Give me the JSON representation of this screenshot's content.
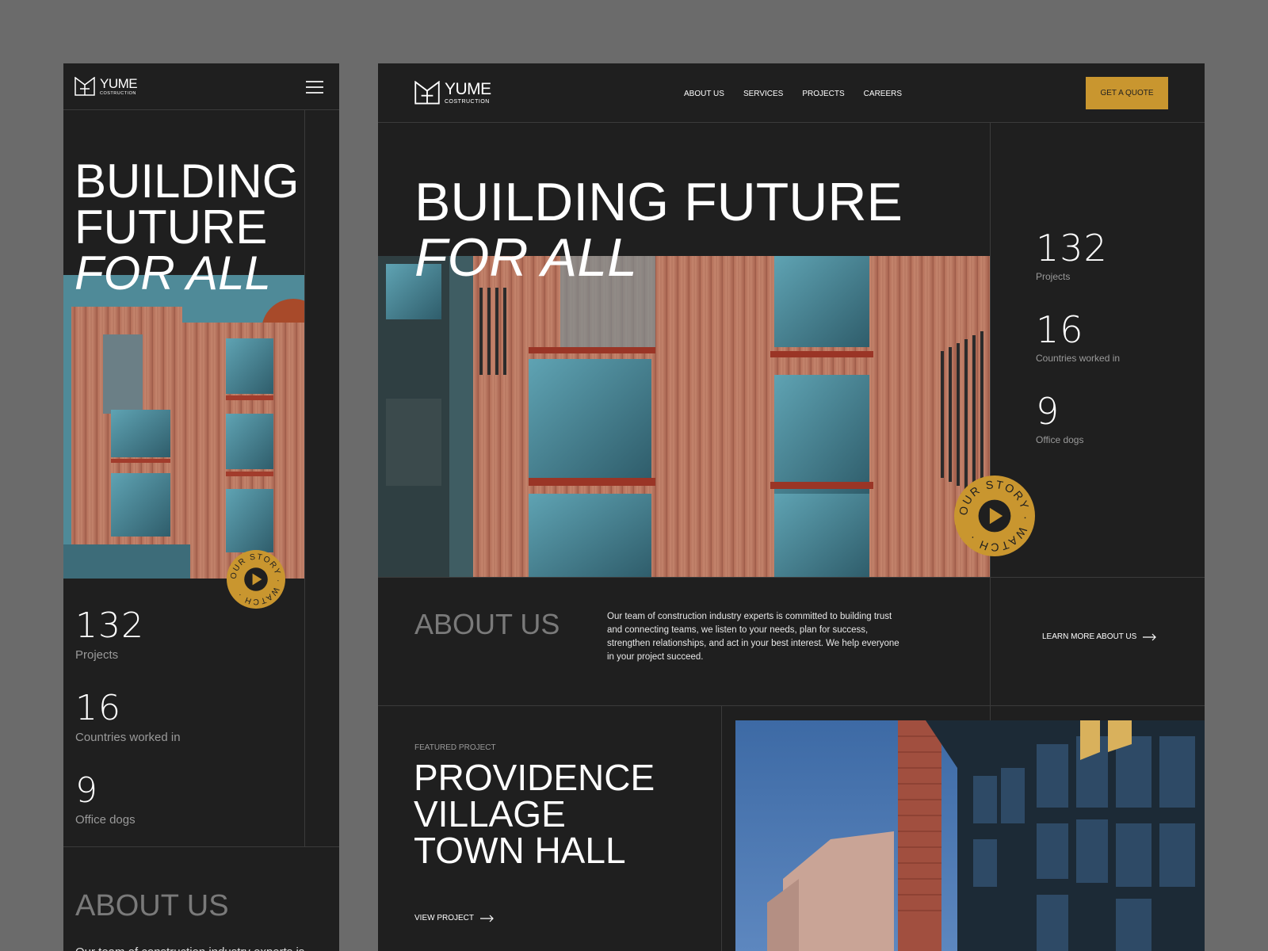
{
  "brand": {
    "name": "YUME",
    "tagline": "COSTRUCTION"
  },
  "nav": [
    {
      "label": "ABOUT US"
    },
    {
      "label": "SERVICES"
    },
    {
      "label": "PROJECTS"
    },
    {
      "label": "CAREERS"
    }
  ],
  "cta_label": "GET A QUOTE",
  "hero": {
    "line1": "BUILDING",
    "line2": "FUTURE",
    "line3": "FOR ALL",
    "desktop_line1": "BUILDING FUTURE"
  },
  "stats": [
    {
      "value": "132",
      "label": "Projects"
    },
    {
      "value": "16",
      "label": "Countries worked in"
    },
    {
      "value": "9",
      "label": "Office dogs"
    }
  ],
  "story_badge": {
    "text": "OUR STORY · WATCH ·"
  },
  "about": {
    "title": "ABOUT US",
    "body": "Our team of construction industry experts is committed to building trust and connecting teams, we listen to your needs, plan for success, strengthen relationships, and act in your best interest. We help everyone in your project succeed.",
    "link": "LEARN MORE ABOUT US",
    "mobile_body_fragment": "Our team of construction industry experts is"
  },
  "featured": {
    "eyebrow": "FEATURED PROJECT",
    "line1": "PROVIDENCE",
    "line2": "VILLAGE",
    "line3": "TOWN HALL",
    "link": "VIEW PROJECT"
  },
  "colors": {
    "bg": "#1f1f1f",
    "accent": "#c9962f",
    "frame": "#6b6b6b"
  }
}
